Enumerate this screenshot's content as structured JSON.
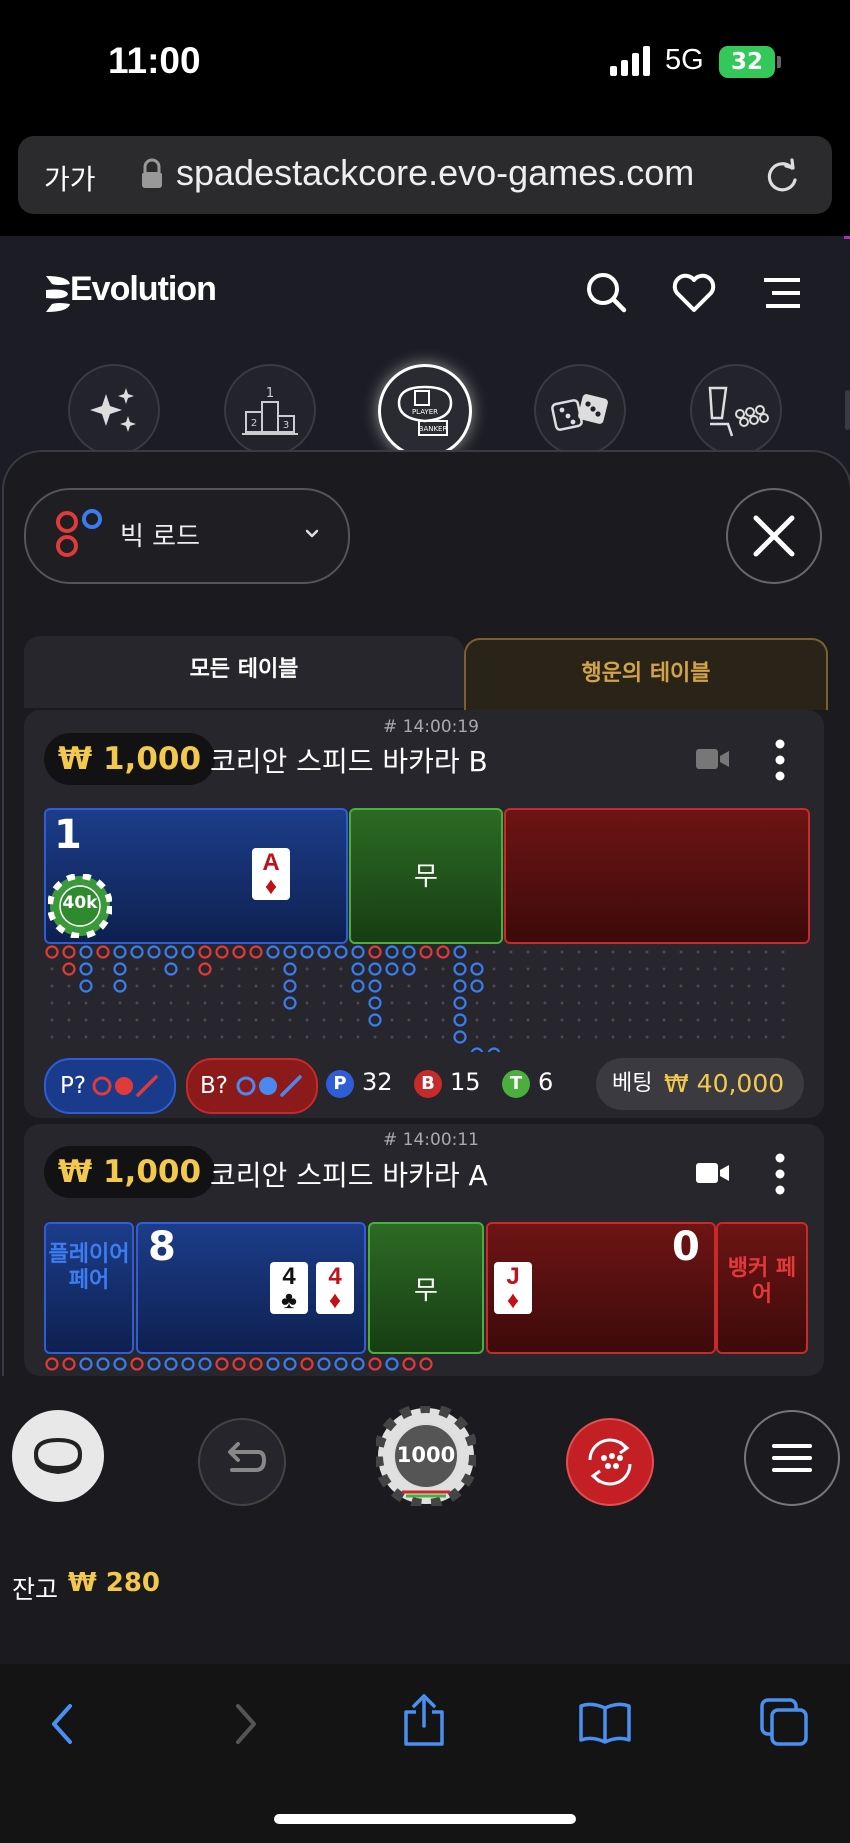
{
  "status_bar": {
    "time": "11:00",
    "network": "5G",
    "battery": "32"
  },
  "browser": {
    "text_size": "가가",
    "url": "spadestackcore.evo-games.com"
  },
  "header": {
    "brand": "Evolution"
  },
  "categories": [
    "sparkles",
    "leaderboard",
    "baccarat",
    "dice",
    "roulette"
  ],
  "road_select": {
    "label": "빅 로드"
  },
  "tabs": {
    "all": "모든 테이블",
    "lucky": "행운의 테이블"
  },
  "tables": [
    {
      "game_id": "# 14:00:19",
      "min_bet": "₩ 1,000",
      "name": "코리안 스피드 바카라 B",
      "player_score": "1",
      "chip": "40k",
      "player_card": {
        "rank": "A",
        "suit": "♦"
      },
      "tie_label": "무",
      "predict_player": "P?",
      "predict_banker": "B?",
      "stats": {
        "p_label": "P",
        "p": "32",
        "b_label": "B",
        "b": "15",
        "t_label": "T",
        "t": "6"
      },
      "bet_label": "베팅",
      "bet_amount": "₩ 40,000"
    },
    {
      "game_id": "# 14:00:11",
      "min_bet": "₩ 1,000",
      "name": "코리안 스피드 바카라 A",
      "player_pair": "플레이어 페어",
      "player_score": "8",
      "player_cards": [
        {
          "rank": "4",
          "suit": "♣"
        },
        {
          "rank": "4",
          "suit": "♦"
        }
      ],
      "tie_label": "무",
      "banker_score": "0",
      "banker_card": {
        "rank": "J",
        "suit": "♦"
      },
      "banker_pair": "뱅커 페어"
    }
  ],
  "bottom_bar": {
    "chip_value": "1000",
    "balance_label": "잔고",
    "balance": "₩ 280"
  },
  "colors": {
    "gold": "#f2c94c",
    "player_blue": "#2e5dd6",
    "banker_red": "#c62a2a",
    "tie_green": "#4cae3e"
  }
}
